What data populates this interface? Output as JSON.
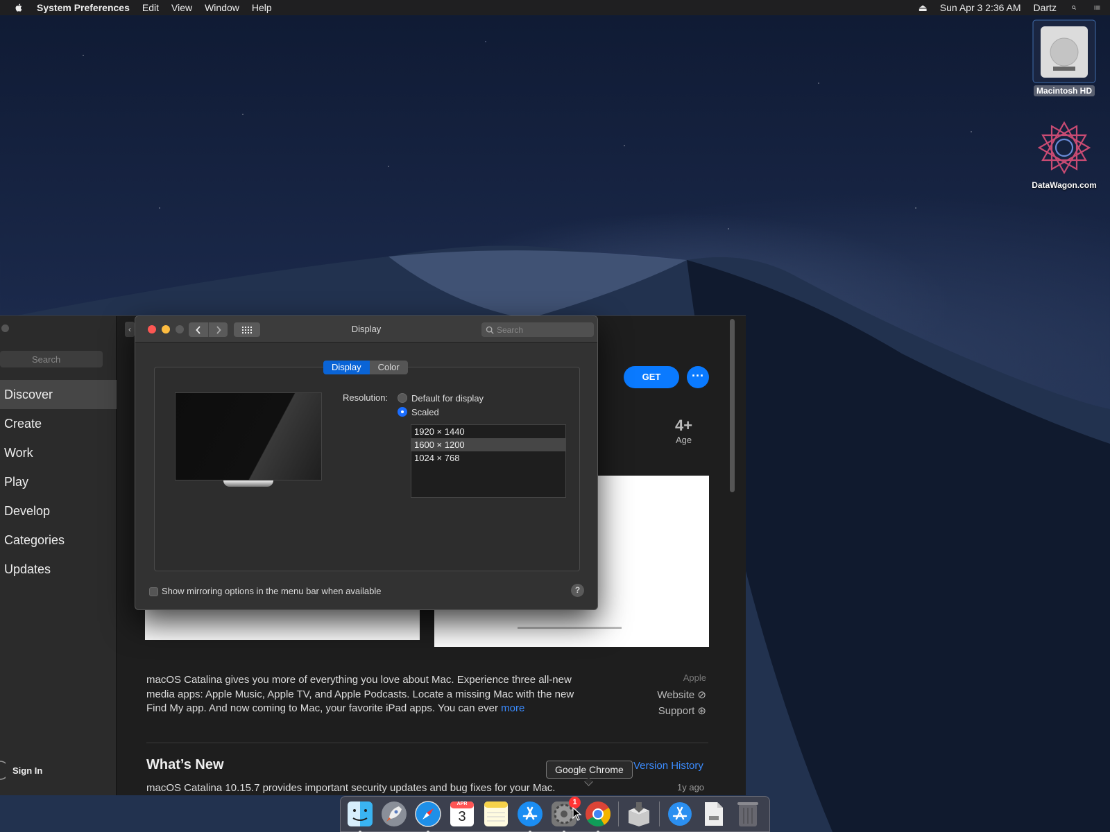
{
  "menubar": {
    "app_name": "System Preferences",
    "menus": [
      "Edit",
      "View",
      "Window",
      "Help"
    ],
    "clock": "Sun Apr 3  2:36 AM",
    "user": "Dartz"
  },
  "desktop": {
    "icons": [
      {
        "label": "Macintosh HD",
        "icon": "hard-drive-icon"
      },
      {
        "label": "DataWagon.com",
        "icon": "datawagon-logo-icon"
      }
    ]
  },
  "appstore": {
    "search_placeholder": "Search",
    "nav": [
      "Discover",
      "Create",
      "Work",
      "Play",
      "Develop",
      "Categories",
      "Updates"
    ],
    "selected_nav": "Discover",
    "sign_in": "Sign In",
    "get_label": "GET",
    "more_options": "···",
    "age_rating": "4+",
    "age_label": "Age",
    "description": "macOS Catalina gives you more of everything you love about Mac. Experience three all-new media apps: Apple Music, Apple TV, and Apple Podcasts. Locate a missing Mac with the new Find My app. And now coming to Mac, your favorite iPad apps. You can ever",
    "more_link": "more",
    "developer": "Apple",
    "website": "Website",
    "support": "Support",
    "whats_new_title": "What’s New",
    "version_history": "Version History",
    "whats_new_text": "macOS Catalina 10.15.7 provides important security updates and bug fixes for your Mac.",
    "whats_new_date": "1y ago"
  },
  "display_prefs": {
    "title": "Display",
    "search_placeholder": "Search",
    "tabs": [
      "Display",
      "Color"
    ],
    "active_tab": "Display",
    "resolution_label": "Resolution:",
    "option_default": "Default for display",
    "option_scaled": "Scaled",
    "selected_option": "Scaled",
    "resolutions": [
      "1920 × 1440",
      "1600 × 1200",
      "1024 × 768"
    ],
    "selected_resolution": "1600 × 1200",
    "mirroring_label": "Show mirroring options in the menu bar when available",
    "mirroring_checked": false,
    "help": "?"
  },
  "tooltip": "Google Chrome",
  "dock": {
    "calendar_day": "3",
    "calendar_month": "APR",
    "system_prefs_badge": "1"
  },
  "colors": {
    "accent": "#0a7aff",
    "link": "#3b8cff",
    "close": "#fc5753",
    "minimize": "#fdbc40"
  }
}
